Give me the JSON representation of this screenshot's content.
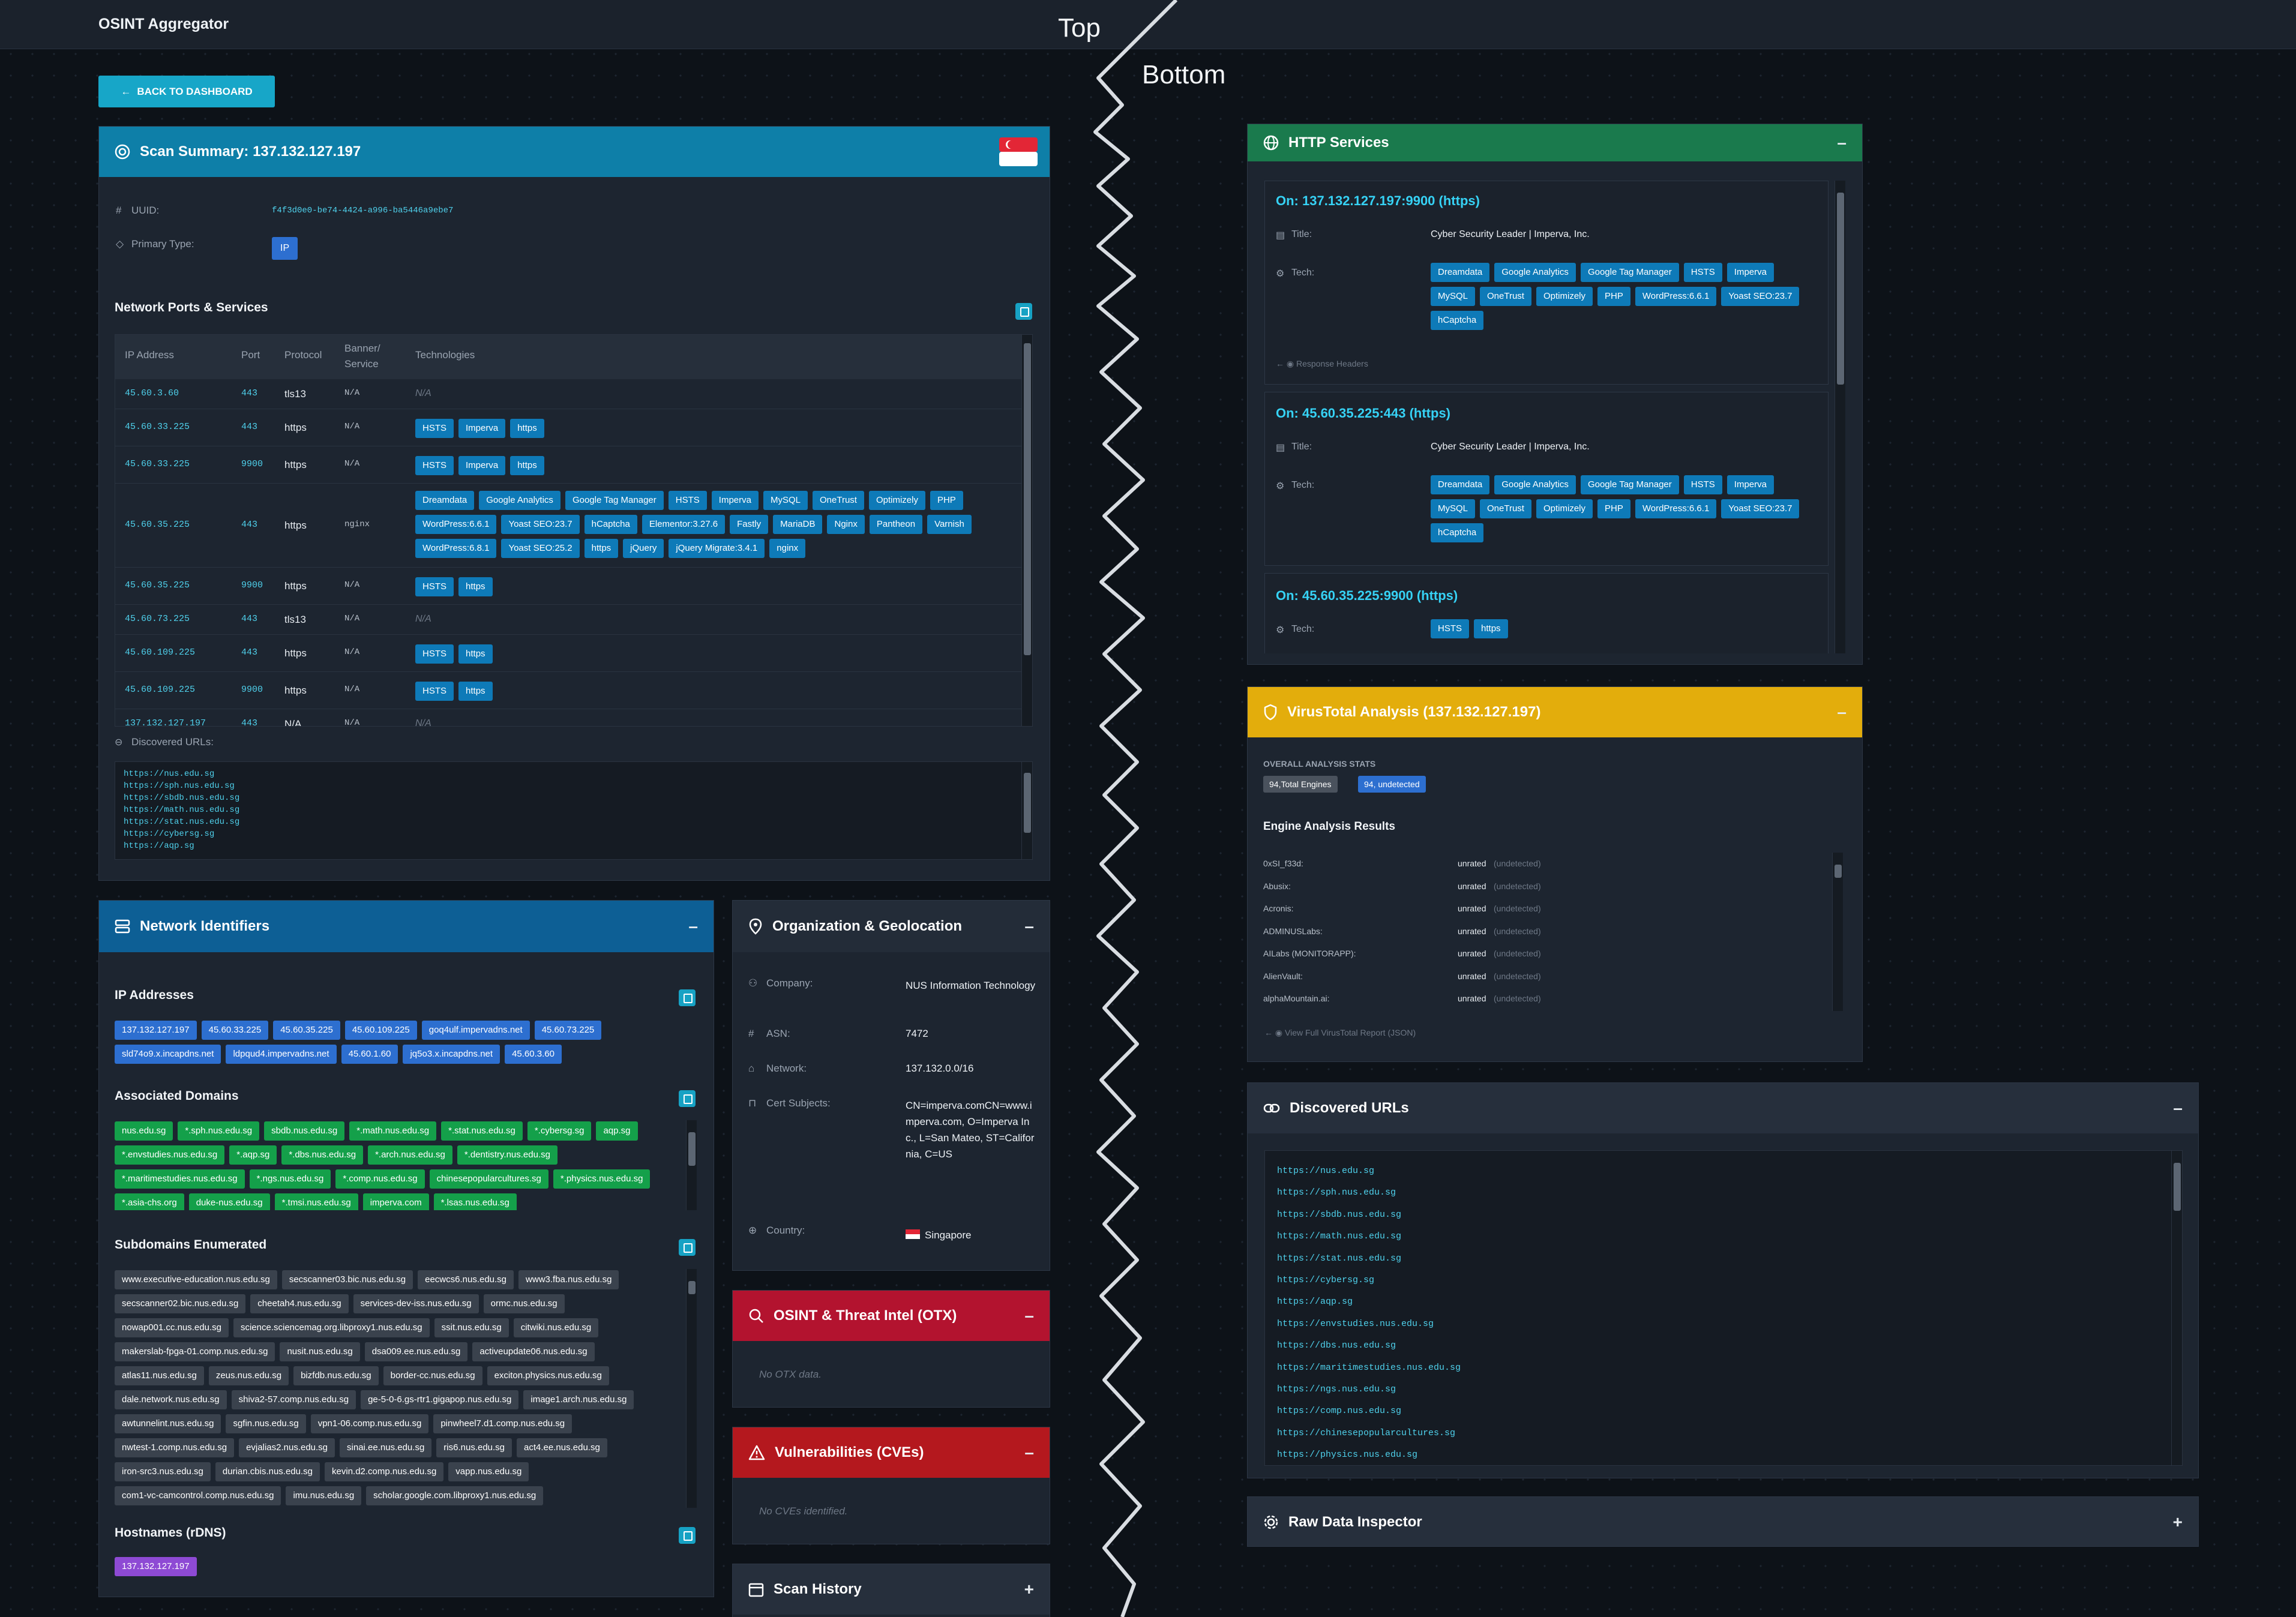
{
  "app_title": "OSINT Aggregator",
  "split_labels": {
    "top": "Top",
    "bottom": "Bottom"
  },
  "back_button": "BACK TO DASHBOARD",
  "summary": {
    "title": "Scan Summary: 137.132.127.197",
    "uuid_label": "UUID:",
    "uuid": "f4f3d0e0-be74-4424-a996-ba5446a9ebe7",
    "primary_type_label": "Primary Type:",
    "primary_type": "IP",
    "ports_title": "Network Ports & Services",
    "columns": [
      "IP Address",
      "Port",
      "Protocol",
      "Banner/ Service",
      "Technologies"
    ],
    "rows": [
      {
        "ip": "45.60.3.60",
        "port": "443",
        "protocol": "tls13",
        "banner": "N/A",
        "tech": [],
        "tech_text": "N/A"
      },
      {
        "ip": "45.60.33.225",
        "port": "443",
        "protocol": "https",
        "banner": "N/A",
        "tech": [
          "HSTS",
          "Imperva",
          "https"
        ],
        "tech_text": ""
      },
      {
        "ip": "45.60.33.225",
        "port": "9900",
        "protocol": "https",
        "banner": "N/A",
        "tech": [
          "HSTS",
          "Imperva",
          "https"
        ],
        "tech_text": ""
      },
      {
        "ip": "45.60.35.225",
        "port": "443",
        "protocol": "https",
        "banner": "nginx",
        "tech": [
          "Dreamdata",
          "Google Analytics",
          "Google Tag Manager",
          "HSTS",
          "Imperva",
          "MySQL",
          "OneTrust",
          "Optimizely",
          "PHP",
          "WordPress:6.6.1",
          "Yoast SEO:23.7",
          "hCaptcha",
          "Elementor:3.27.6",
          "Fastly",
          "MariaDB",
          "Nginx",
          "Pantheon",
          "Varnish",
          "WordPress:6.8.1",
          "Yoast SEO:25.2",
          "https",
          "jQuery",
          "jQuery Migrate:3.4.1",
          "nginx"
        ],
        "tech_text": ""
      },
      {
        "ip": "45.60.35.225",
        "port": "9900",
        "protocol": "https",
        "banner": "N/A",
        "tech": [
          "HSTS",
          "https"
        ],
        "tech_text": ""
      },
      {
        "ip": "45.60.73.225",
        "port": "443",
        "protocol": "tls13",
        "banner": "N/A",
        "tech": [],
        "tech_text": "N/A"
      },
      {
        "ip": "45.60.109.225",
        "port": "443",
        "protocol": "https",
        "banner": "N/A",
        "tech": [
          "HSTS",
          "https"
        ],
        "tech_text": ""
      },
      {
        "ip": "45.60.109.225",
        "port": "9900",
        "protocol": "https",
        "banner": "N/A",
        "tech": [
          "HSTS",
          "https"
        ],
        "tech_text": ""
      },
      {
        "ip": "137.132.127.197",
        "port": "443",
        "protocol": "N/A",
        "banner": "N/A",
        "tech": [],
        "tech_text": "N/A"
      }
    ],
    "discovered_label": "Discovered URLs:",
    "urls": [
      "https://nus.edu.sg",
      "https://sph.nus.edu.sg",
      "https://sbdb.nus.edu.sg",
      "https://math.nus.edu.sg",
      "https://stat.nus.edu.sg",
      "https://cybersg.sg",
      "https://aqp.sg"
    ]
  },
  "network_identifiers": {
    "title": "Network Identifiers",
    "ip_title": "IP Addresses",
    "ips": [
      "137.132.127.197",
      "45.60.33.225",
      "45.60.35.225",
      "45.60.109.225",
      "goq4ulf.impervadns.net",
      "45.60.73.225",
      "sld74o9.x.incapdns.net",
      "ldpqud4.impervadns.net",
      "45.60.1.60",
      "jq5o3.x.incapdns.net",
      "45.60.3.60"
    ],
    "domains_title": "Associated Domains",
    "domains": [
      "nus.edu.sg",
      "*.sph.nus.edu.sg",
      "sbdb.nus.edu.sg",
      "*.math.nus.edu.sg",
      "*.stat.nus.edu.sg",
      "*.cybersg.sg",
      "aqp.sg",
      "*.envstudies.nus.edu.sg",
      "*.aqp.sg",
      "*.dbs.nus.edu.sg",
      "*.arch.nus.edu.sg",
      "*.dentistry.nus.edu.sg",
      "*.maritimestudies.nus.edu.sg",
      "*.ngs.nus.edu.sg",
      "*.comp.nus.edu.sg",
      "chinesepopularcultures.sg",
      "*.physics.nus.edu.sg",
      "*.asia-chs.org",
      "duke-nus.edu.sg",
      "*.tmsi.nus.edu.sg",
      "imperva.com",
      "*.lsas.nus.edu.sg"
    ],
    "subdomains_title": "Subdomains Enumerated",
    "subdomains": [
      "www.executive-education.nus.edu.sg",
      "secscanner03.bic.nus.edu.sg",
      "eecwcs6.nus.edu.sg",
      "www3.fba.nus.edu.sg",
      "secscanner02.bic.nus.edu.sg",
      "cheetah4.nus.edu.sg",
      "services-dev-iss.nus.edu.sg",
      "ormc.nus.edu.sg",
      "nowap001.cc.nus.edu.sg",
      "science.sciencemag.org.libproxy1.nus.edu.sg",
      "ssit.nus.edu.sg",
      "citwiki.nus.edu.sg",
      "makerslab-fpga-01.comp.nus.edu.sg",
      "nusit.nus.edu.sg",
      "dsa009.ee.nus.edu.sg",
      "activeupdate06.nus.edu.sg",
      "atlas11.nus.edu.sg",
      "zeus.nus.edu.sg",
      "bizfdb.nus.edu.sg",
      "border-cc.nus.edu.sg",
      "exciton.physics.nus.edu.sg",
      "dale.network.nus.edu.sg",
      "shiva2-57.comp.nus.edu.sg",
      "ge-5-0-6.gs-rtr1.gigapop.nus.edu.sg",
      "image1.arch.nus.edu.sg",
      "awtunnelint.nus.edu.sg",
      "sgfin.nus.edu.sg",
      "vpn1-06.comp.nus.edu.sg",
      "pinwheel7.d1.comp.nus.edu.sg",
      "nwtest-1.comp.nus.edu.sg",
      "evjalias2.nus.edu.sg",
      "sinai.ee.nus.edu.sg",
      "ris6.nus.edu.sg",
      "act4.ee.nus.edu.sg",
      "iron-src3.nus.edu.sg",
      "durian.cbis.nus.edu.sg",
      "kevin.d2.comp.nus.edu.sg",
      "vapp.nus.edu.sg",
      "com1-vc-camcontrol.comp.nus.edu.sg",
      "imu.nus.edu.sg",
      "scholar.google.com.libproxy1.nus.edu.sg"
    ],
    "hostnames_title": "Hostnames (rDNS)",
    "hostnames": [
      "137.132.127.197"
    ]
  },
  "org": {
    "title": "Organization & Geolocation",
    "company_label": "Company:",
    "company": "NUS Information Technology",
    "asn_label": "ASN:",
    "asn": "7472",
    "network_label": "Network:",
    "network": "137.132.0.0/16",
    "cert_label": "Cert Subjects:",
    "cert": "CN=imperva.comCN=www.imperva.com, O=Imperva Inc., L=San Mateo, ST=California, C=US",
    "country_label": "Country:",
    "country": "Singapore"
  },
  "otx": {
    "title": "OSINT & Threat Intel (OTX)",
    "empty": "No OTX data."
  },
  "cves": {
    "title": "Vulnerabilities (CVEs)",
    "empty": "No CVEs identified."
  },
  "history": {
    "title": "Scan History"
  },
  "http_services": {
    "title": "HTTP Services",
    "title_label": "Title:",
    "tech_label": "Tech:",
    "response_headers": "Response Headers",
    "entries": [
      {
        "heading": "On: 137.132.127.197:9900 (https)",
        "title": "Cyber Security Leader | Imperva, Inc.",
        "tech": [
          "Dreamdata",
          "Google Analytics",
          "Google Tag Manager",
          "HSTS",
          "Imperva",
          "MySQL",
          "OneTrust",
          "Optimizely",
          "PHP",
          "WordPress:6.6.1",
          "Yoast SEO:23.7",
          "hCaptcha"
        ]
      },
      {
        "heading": "On: 45.60.35.225:443 (https)",
        "title": "Cyber Security Leader | Imperva, Inc.",
        "tech": [
          "Dreamdata",
          "Google Analytics",
          "Google Tag Manager",
          "HSTS",
          "Imperva",
          "MySQL",
          "OneTrust",
          "Optimizely",
          "PHP",
          "WordPress:6.6.1",
          "Yoast SEO:23.7",
          "hCaptcha"
        ]
      },
      {
        "heading": "On: 45.60.35.225:9900 (https)",
        "title": "",
        "tech": [
          "HSTS",
          "https"
        ]
      }
    ]
  },
  "virustotal": {
    "title": "VirusTotal Analysis (137.132.127.197)",
    "stats_label": "OVERALL ANALYSIS STATS",
    "stat_total": "94,Total Engines",
    "stat_undetected": "94, undetected",
    "engines_title": "Engine Analysis Results",
    "engines": [
      {
        "name": "0xSI_f33d:",
        "result": "unrated",
        "note": "(undetected)"
      },
      {
        "name": "Abusix:",
        "result": "unrated",
        "note": "(undetected)"
      },
      {
        "name": "Acronis:",
        "result": "unrated",
        "note": "(undetected)"
      },
      {
        "name": "ADMINUSLabs:",
        "result": "unrated",
        "note": "(undetected)"
      },
      {
        "name": "AILabs (MONITORAPP):",
        "result": "unrated",
        "note": "(undetected)"
      },
      {
        "name": "AlienVault:",
        "result": "unrated",
        "note": "(undetected)"
      },
      {
        "name": "alphaMountain.ai:",
        "result": "unrated",
        "note": "(undetected)"
      }
    ],
    "full_report": "View Full VirusTotal Report (JSON)"
  },
  "discovered_urls": {
    "title": "Discovered URLs",
    "urls": [
      "https://nus.edu.sg",
      "https://sph.nus.edu.sg",
      "https://sbdb.nus.edu.sg",
      "https://math.nus.edu.sg",
      "https://stat.nus.edu.sg",
      "https://cybersg.sg",
      "https://aqp.sg",
      "https://envstudies.nus.edu.sg",
      "https://dbs.nus.edu.sg",
      "https://maritimestudies.nus.edu.sg",
      "https://ngs.nus.edu.sg",
      "https://comp.nus.edu.sg",
      "https://chinesepopularcultures.sg",
      "https://physics.nus.edu.sg"
    ]
  },
  "raw_data": {
    "title": "Raw Data Inspector"
  },
  "colors": {
    "summary_header": "#0e7fa8",
    "identifiers_header": "#0d5f95",
    "http_header": "#1a7a4d",
    "vt_header": "#e3ad0c",
    "otx_header": "#b3132f",
    "cve_header": "#b4181e",
    "accent_cyan": "#36d2f5"
  },
  "icons": [
    "target-icon",
    "tag-icon",
    "fingerprint-icon",
    "server-icon",
    "map-pin-icon",
    "globe-icon",
    "shield-icon",
    "link-icon",
    "search-icon",
    "warning-icon",
    "calendar-icon",
    "gear-icon",
    "copy-icon",
    "flag-singapore-icon",
    "arrow-left-icon",
    "eye-icon"
  ]
}
